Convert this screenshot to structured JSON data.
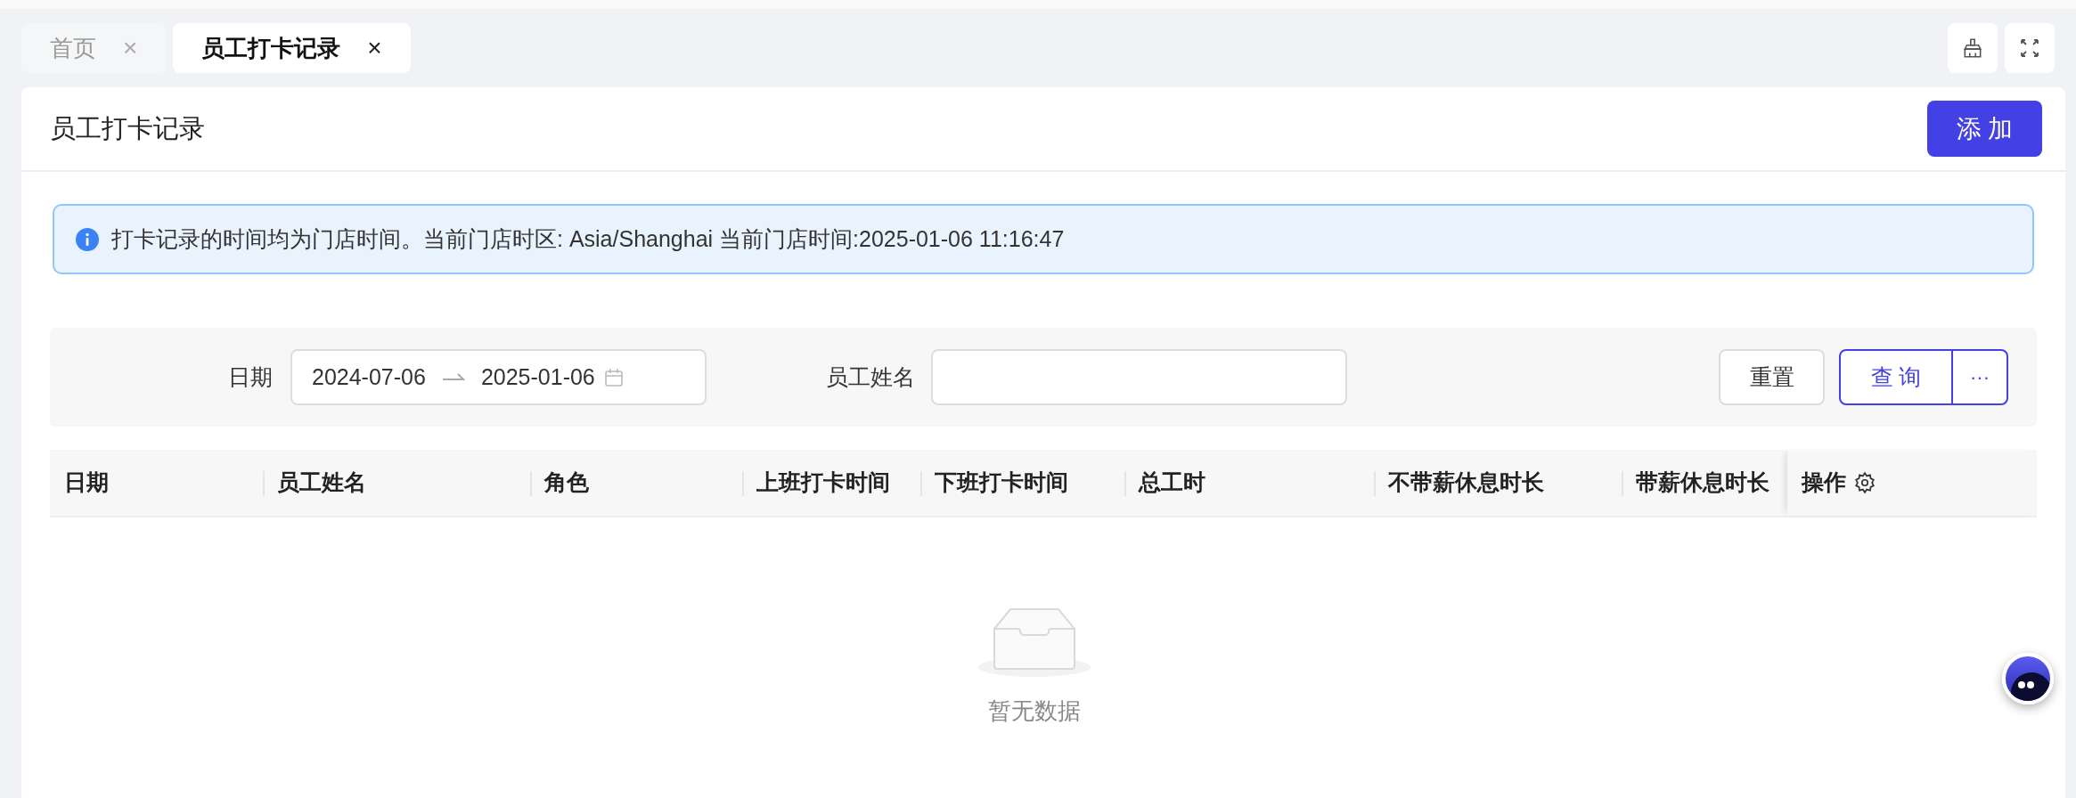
{
  "tabs": [
    {
      "label": "首页",
      "selected": false,
      "close": "×"
    },
    {
      "label": "员工打卡记录",
      "selected": true,
      "close": "×"
    }
  ],
  "page": {
    "title": "员工打卡记录",
    "add_button": "添 加"
  },
  "alert": {
    "text": "打卡记录的时间均为门店时间。当前门店时区: Asia/Shanghai 当前门店时间:2025-01-06 11:16:47"
  },
  "filters": {
    "date_label": "日期",
    "date_start": "2024-07-06",
    "date_end": "2025-01-06",
    "name_label": "员工姓名",
    "reset_button": "重置",
    "query_button": "查 询",
    "more_button": "···"
  },
  "table": {
    "columns": [
      {
        "label": "日期"
      },
      {
        "label": "员工姓名"
      },
      {
        "label": "角色"
      },
      {
        "label": "上班打卡时间"
      },
      {
        "label": "下班打卡时间"
      },
      {
        "label": "总工时"
      },
      {
        "label": "不带薪休息时长"
      },
      {
        "label": "带薪休息时长"
      },
      {
        "label": "操作",
        "kind": "settings"
      }
    ],
    "empty_text": "暂无数据"
  }
}
